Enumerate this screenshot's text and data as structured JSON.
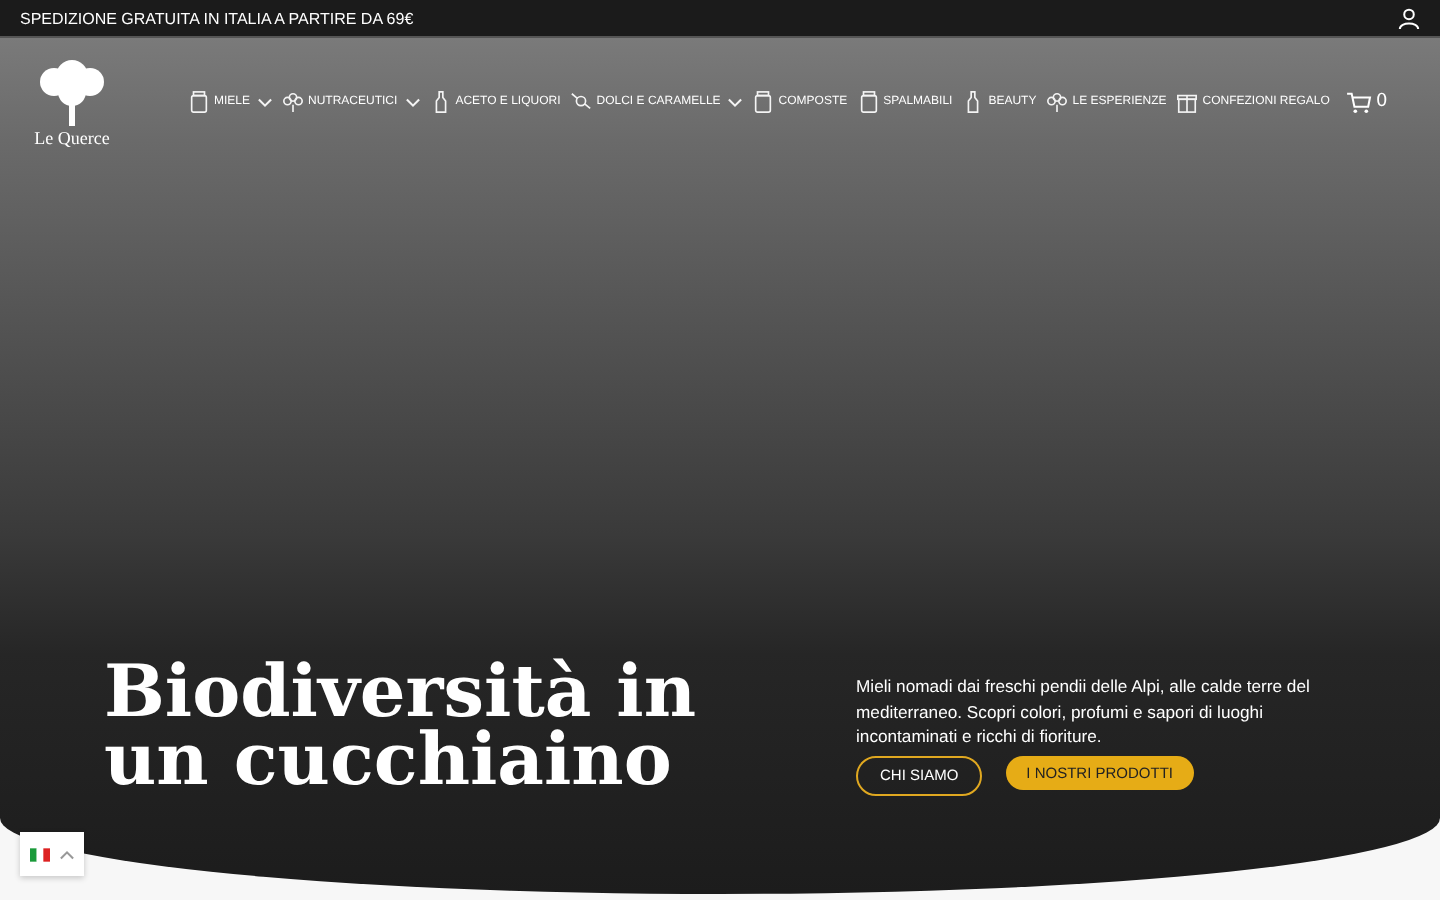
{
  "top_bar": {
    "text": "SPEDIZIONE GRATUITA IN ITALIA A PARTIRE DA 69€"
  },
  "logo": {
    "text": "Le Querce"
  },
  "nav": [
    {
      "label": "MIELE",
      "has_submenu": true
    },
    {
      "label": "NUTRACEUTICI",
      "has_submenu": true
    },
    {
      "label": "ACETO E LIQUORI",
      "has_submenu": false
    },
    {
      "label": "DOLCI E CARAMELLE",
      "has_submenu": true
    },
    {
      "label": "COMPOSTE",
      "has_submenu": false
    },
    {
      "label": "SPALMABILI",
      "has_submenu": false
    },
    {
      "label": "BEAUTY",
      "has_submenu": false
    },
    {
      "label": "LE ESPERIENZE",
      "has_submenu": false
    },
    {
      "label": "CONFEZIONI REGALO",
      "has_submenu": false
    }
  ],
  "cart": {
    "count": "0"
  },
  "hero": {
    "title": "Biodiversità in un cucchiaino",
    "description": "Mieli nomadi dai freschi pendii delle Alpi, alle calde terre del mediterraneo. Scopri colori, profumi e sapori di luoghi incontaminati e ricchi di fioriture.",
    "buttons": [
      {
        "label": "CHI SIAMO",
        "kind": "outline"
      },
      {
        "label": "I NOSTRI PRODOTTI",
        "kind": "filled"
      }
    ]
  },
  "language": {
    "expanded": false
  }
}
